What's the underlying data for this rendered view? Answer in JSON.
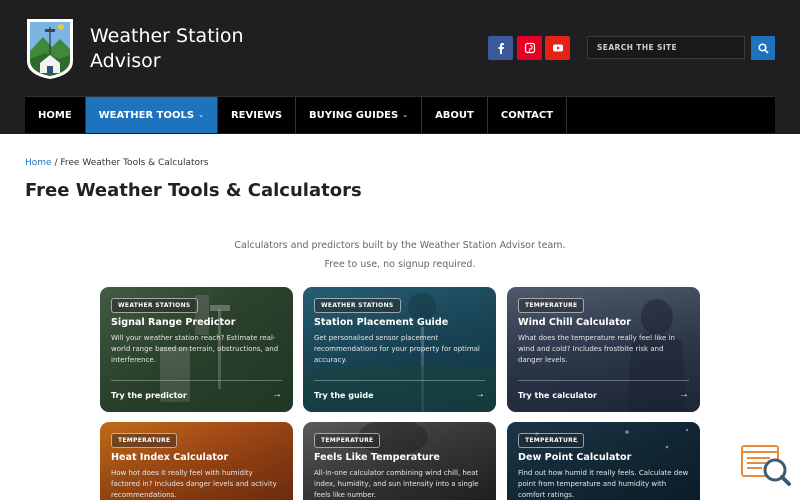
{
  "site": {
    "title_line1": "Weather Station",
    "title_line2": "Advisor"
  },
  "social": [
    "facebook-icon",
    "pinterest-icon",
    "youtube-icon"
  ],
  "search": {
    "placeholder": "SEARCH THE SITE"
  },
  "nav": {
    "home": "HOME",
    "weather_tools": "WEATHER TOOLS",
    "reviews": "REVIEWS",
    "buying_guides": "BUYING GUIDES",
    "about": "ABOUT",
    "contact": "CONTACT"
  },
  "breadcrumb": {
    "home": "Home",
    "separator": "/",
    "current": "Free Weather Tools & Calculators"
  },
  "page_title": "Free Weather Tools & Calculators",
  "intro": {
    "line1": "Calculators and predictors built by the Weather Station Advisor team.",
    "line2": "Free to use, no signup required."
  },
  "cards": [
    {
      "badge": "WEATHER STATIONS",
      "title": "Signal Range Predictor",
      "desc": "Will your weather station reach? Estimate real-world range based on terrain, obstructions, and interference.",
      "cta": "Try the predictor"
    },
    {
      "badge": "WEATHER STATIONS",
      "title": "Station Placement Guide",
      "desc": "Get personalised sensor placement recommendations for your property for optimal accuracy.",
      "cta": "Try the guide"
    },
    {
      "badge": "TEMPERATURE",
      "title": "Wind Chill Calculator",
      "desc": "What does the temperature really feel like in wind and cold? Includes frostbite risk and danger levels.",
      "cta": "Try the calculator"
    },
    {
      "badge": "TEMPERATURE",
      "title": "Heat Index Calculator",
      "desc": "How hot does it really feel with humidity factored in? Includes danger levels and activity recommendations."
    },
    {
      "badge": "TEMPERATURE",
      "title": "Feels Like Temperature",
      "desc": "All-in-one calculator combining wind chill, heat index, humidity, and sun intensity into a single feels like number."
    },
    {
      "badge": "TEMPERATURE",
      "title": "Dew Point Calculator",
      "desc": "Find out how humid it really feels. Calculate dew point from temperature and humidity with comfort ratings."
    }
  ],
  "colors": {
    "header_bg": "#1f1f22",
    "accent": "#1e73be",
    "nav_bg": "#000000"
  }
}
